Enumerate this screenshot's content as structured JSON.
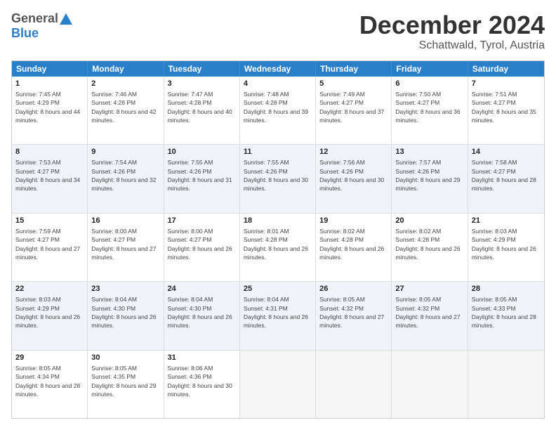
{
  "logo": {
    "general": "General",
    "blue": "Blue"
  },
  "header": {
    "month": "December 2024",
    "location": "Schattwald, Tyrol, Austria"
  },
  "weekdays": [
    "Sunday",
    "Monday",
    "Tuesday",
    "Wednesday",
    "Thursday",
    "Friday",
    "Saturday"
  ],
  "rows": [
    [
      {
        "day": "1",
        "rise": "Sunrise: 7:45 AM",
        "set": "Sunset: 4:29 PM",
        "daylight": "Daylight: 8 hours and 44 minutes."
      },
      {
        "day": "2",
        "rise": "Sunrise: 7:46 AM",
        "set": "Sunset: 4:28 PM",
        "daylight": "Daylight: 8 hours and 42 minutes."
      },
      {
        "day": "3",
        "rise": "Sunrise: 7:47 AM",
        "set": "Sunset: 4:28 PM",
        "daylight": "Daylight: 8 hours and 40 minutes."
      },
      {
        "day": "4",
        "rise": "Sunrise: 7:48 AM",
        "set": "Sunset: 4:28 PM",
        "daylight": "Daylight: 8 hours and 39 minutes."
      },
      {
        "day": "5",
        "rise": "Sunrise: 7:49 AM",
        "set": "Sunset: 4:27 PM",
        "daylight": "Daylight: 8 hours and 37 minutes."
      },
      {
        "day": "6",
        "rise": "Sunrise: 7:50 AM",
        "set": "Sunset: 4:27 PM",
        "daylight": "Daylight: 8 hours and 36 minutes."
      },
      {
        "day": "7",
        "rise": "Sunrise: 7:51 AM",
        "set": "Sunset: 4:27 PM",
        "daylight": "Daylight: 8 hours and 35 minutes."
      }
    ],
    [
      {
        "day": "8",
        "rise": "Sunrise: 7:53 AM",
        "set": "Sunset: 4:27 PM",
        "daylight": "Daylight: 8 hours and 34 minutes."
      },
      {
        "day": "9",
        "rise": "Sunrise: 7:54 AM",
        "set": "Sunset: 4:26 PM",
        "daylight": "Daylight: 8 hours and 32 minutes."
      },
      {
        "day": "10",
        "rise": "Sunrise: 7:55 AM",
        "set": "Sunset: 4:26 PM",
        "daylight": "Daylight: 8 hours and 31 minutes."
      },
      {
        "day": "11",
        "rise": "Sunrise: 7:55 AM",
        "set": "Sunset: 4:26 PM",
        "daylight": "Daylight: 8 hours and 30 minutes."
      },
      {
        "day": "12",
        "rise": "Sunrise: 7:56 AM",
        "set": "Sunset: 4:26 PM",
        "daylight": "Daylight: 8 hours and 30 minutes."
      },
      {
        "day": "13",
        "rise": "Sunrise: 7:57 AM",
        "set": "Sunset: 4:26 PM",
        "daylight": "Daylight: 8 hours and 29 minutes."
      },
      {
        "day": "14",
        "rise": "Sunrise: 7:58 AM",
        "set": "Sunset: 4:27 PM",
        "daylight": "Daylight: 8 hours and 28 minutes."
      }
    ],
    [
      {
        "day": "15",
        "rise": "Sunrise: 7:59 AM",
        "set": "Sunset: 4:27 PM",
        "daylight": "Daylight: 8 hours and 27 minutes."
      },
      {
        "day": "16",
        "rise": "Sunrise: 8:00 AM",
        "set": "Sunset: 4:27 PM",
        "daylight": "Daylight: 8 hours and 27 minutes."
      },
      {
        "day": "17",
        "rise": "Sunrise: 8:00 AM",
        "set": "Sunset: 4:27 PM",
        "daylight": "Daylight: 8 hours and 26 minutes."
      },
      {
        "day": "18",
        "rise": "Sunrise: 8:01 AM",
        "set": "Sunset: 4:28 PM",
        "daylight": "Daylight: 8 hours and 26 minutes."
      },
      {
        "day": "19",
        "rise": "Sunrise: 8:02 AM",
        "set": "Sunset: 4:28 PM",
        "daylight": "Daylight: 8 hours and 26 minutes."
      },
      {
        "day": "20",
        "rise": "Sunrise: 8:02 AM",
        "set": "Sunset: 4:28 PM",
        "daylight": "Daylight: 8 hours and 26 minutes."
      },
      {
        "day": "21",
        "rise": "Sunrise: 8:03 AM",
        "set": "Sunset: 4:29 PM",
        "daylight": "Daylight: 8 hours and 26 minutes."
      }
    ],
    [
      {
        "day": "22",
        "rise": "Sunrise: 8:03 AM",
        "set": "Sunset: 4:29 PM",
        "daylight": "Daylight: 8 hours and 26 minutes."
      },
      {
        "day": "23",
        "rise": "Sunrise: 8:04 AM",
        "set": "Sunset: 4:30 PM",
        "daylight": "Daylight: 8 hours and 26 minutes."
      },
      {
        "day": "24",
        "rise": "Sunrise: 8:04 AM",
        "set": "Sunset: 4:30 PM",
        "daylight": "Daylight: 8 hours and 26 minutes."
      },
      {
        "day": "25",
        "rise": "Sunrise: 8:04 AM",
        "set": "Sunset: 4:31 PM",
        "daylight": "Daylight: 8 hours and 26 minutes."
      },
      {
        "day": "26",
        "rise": "Sunrise: 8:05 AM",
        "set": "Sunset: 4:32 PM",
        "daylight": "Daylight: 8 hours and 27 minutes."
      },
      {
        "day": "27",
        "rise": "Sunrise: 8:05 AM",
        "set": "Sunset: 4:32 PM",
        "daylight": "Daylight: 8 hours and 27 minutes."
      },
      {
        "day": "28",
        "rise": "Sunrise: 8:05 AM",
        "set": "Sunset: 4:33 PM",
        "daylight": "Daylight: 8 hours and 28 minutes."
      }
    ],
    [
      {
        "day": "29",
        "rise": "Sunrise: 8:05 AM",
        "set": "Sunset: 4:34 PM",
        "daylight": "Daylight: 8 hours and 28 minutes."
      },
      {
        "day": "30",
        "rise": "Sunrise: 8:05 AM",
        "set": "Sunset: 4:35 PM",
        "daylight": "Daylight: 8 hours and 29 minutes."
      },
      {
        "day": "31",
        "rise": "Sunrise: 8:06 AM",
        "set": "Sunset: 4:36 PM",
        "daylight": "Daylight: 8 hours and 30 minutes."
      },
      {
        "day": "",
        "rise": "",
        "set": "",
        "daylight": ""
      },
      {
        "day": "",
        "rise": "",
        "set": "",
        "daylight": ""
      },
      {
        "day": "",
        "rise": "",
        "set": "",
        "daylight": ""
      },
      {
        "day": "",
        "rise": "",
        "set": "",
        "daylight": ""
      }
    ]
  ]
}
